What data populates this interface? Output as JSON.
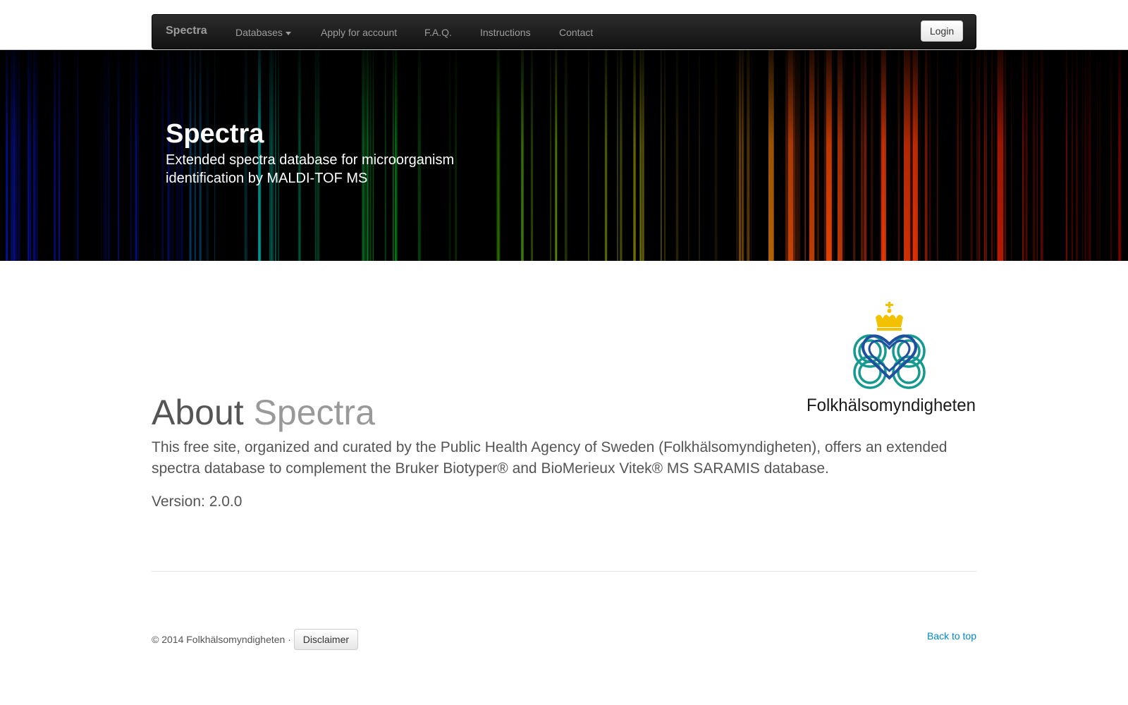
{
  "navbar": {
    "brand": "Spectra",
    "items": [
      {
        "label": "Databases",
        "has_caret": true
      },
      {
        "label": "Apply for account"
      },
      {
        "label": "F.A.Q."
      },
      {
        "label": "Instructions"
      },
      {
        "label": "Contact"
      }
    ],
    "login_label": "Login"
  },
  "hero": {
    "title": "Spectra",
    "subtitle": "Extended spectra database for microorganism identification by MALDI-TOF MS"
  },
  "logo": {
    "text": "Folkhälsomyndigheten",
    "colors": {
      "crown": "#f2c100",
      "heart": "#1f4fa0",
      "rings": "#159a8f",
      "text": "#1a1a1a"
    }
  },
  "about": {
    "heading_main": "About",
    "heading_muted": "Spectra",
    "description": "This free site, organized and curated by the Public Health Agency of Sweden (Folkhälsomyndigheten), offers an extended spectra database to complement the Bruker Biotyper® and BioMerieux Vitek® MS SARAMIS database.",
    "version_label": "Version:",
    "version_value": "2.0.0"
  },
  "footer": {
    "copyright": "© 2014 Folkhälsomyndigheten ·",
    "disclaimer_label": "Disclaimer",
    "back_to_top": "Back to top"
  },
  "colors": {
    "navbar_bg": "#1b1b1b",
    "nav_text": "#9d9d9d",
    "link": "#0088cc",
    "text": "#555555",
    "muted": "#999999"
  }
}
